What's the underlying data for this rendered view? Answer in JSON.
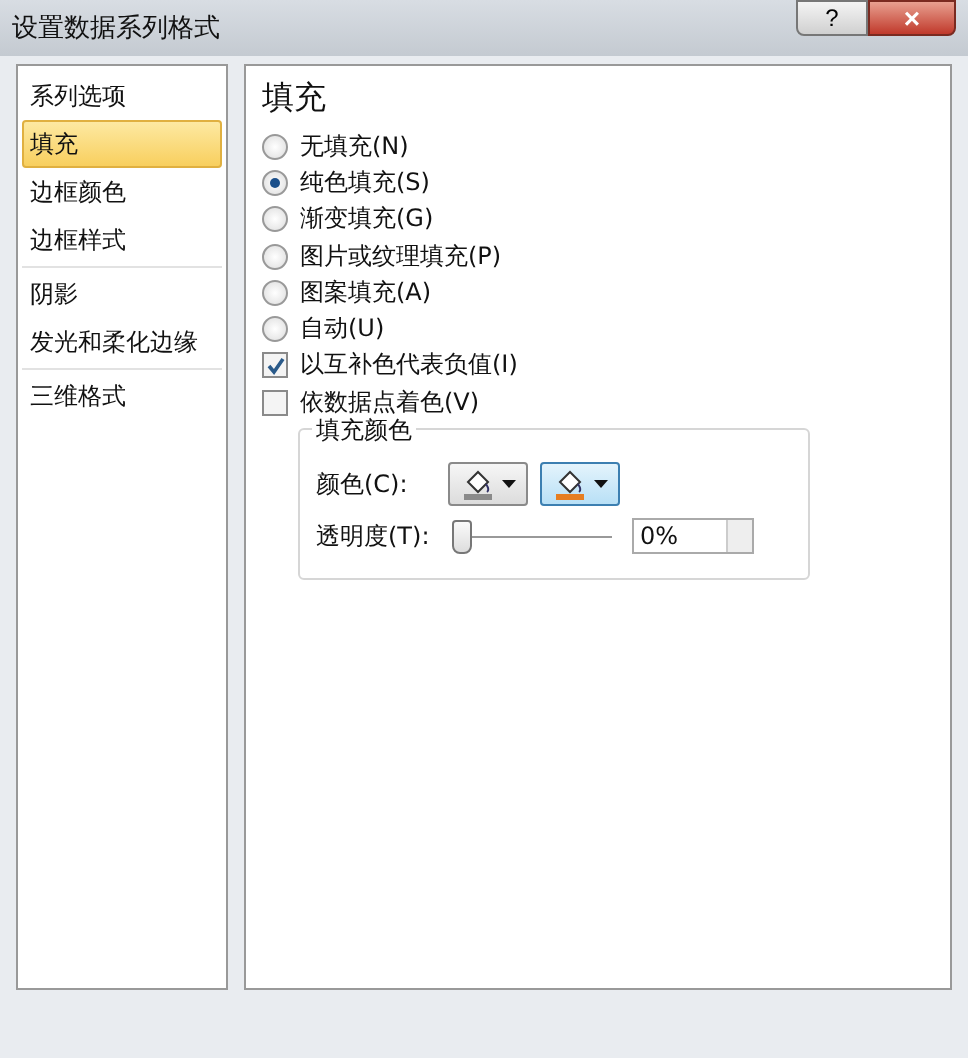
{
  "window": {
    "title": "设置数据系列格式",
    "help": "?",
    "close": "×"
  },
  "sidebar": {
    "items": [
      {
        "label": "系列选项",
        "selected": false,
        "divider": false
      },
      {
        "label": "填充",
        "selected": true,
        "divider": false
      },
      {
        "label": "边框颜色",
        "selected": false,
        "divider": false
      },
      {
        "label": "边框样式",
        "selected": false,
        "divider": true
      },
      {
        "label": "阴影",
        "selected": false,
        "divider": false
      },
      {
        "label": "发光和柔化边缘",
        "selected": false,
        "divider": true
      },
      {
        "label": "三维格式",
        "selected": false,
        "divider": false
      }
    ]
  },
  "panel": {
    "heading": "填充",
    "options": [
      {
        "kind": "radio",
        "label": "无填充(N)",
        "checked": false
      },
      {
        "kind": "radio",
        "label": "纯色填充(S)",
        "checked": true
      },
      {
        "kind": "radio",
        "label": "渐变填充(G)",
        "checked": false
      },
      {
        "kind": "radio",
        "label": "图片或纹理填充(P)",
        "checked": false
      },
      {
        "kind": "radio",
        "label": "图案填充(A)",
        "checked": false
      },
      {
        "kind": "radio",
        "label": "自动(U)",
        "checked": false
      },
      {
        "kind": "checkbox",
        "label": "以互补色代表负值(I)",
        "checked": true
      },
      {
        "kind": "checkbox",
        "label": "依数据点着色(V)",
        "checked": false
      }
    ],
    "group": {
      "title": "填充颜色",
      "color_label": "颜色(C):",
      "color_buttons": [
        {
          "color": "#8a8a8a",
          "highlighted": false
        },
        {
          "color": "#e67e22",
          "highlighted": true
        }
      ],
      "transparency_label": "透明度(T):",
      "transparency": {
        "level": 0
      },
      "transparency_value": "0%"
    }
  }
}
